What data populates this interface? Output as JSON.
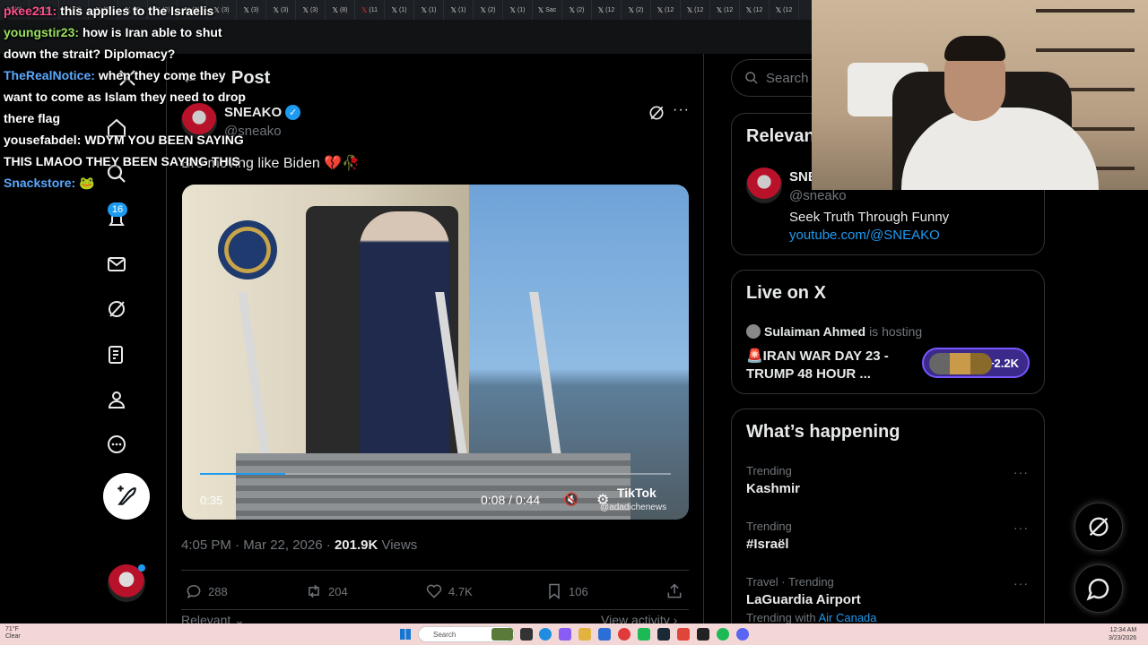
{
  "browser": {
    "tabs": [
      {
        "label": "(3)",
        "red": false
      },
      {
        "label": "(3)",
        "red": false
      },
      {
        "label": "(3)",
        "red": false
      },
      {
        "label": "(3)",
        "red": false
      },
      {
        "label": "(3)",
        "red": false
      },
      {
        "label": "(3)",
        "red": false
      },
      {
        "label": "(3)",
        "red": false
      },
      {
        "label": "(3)",
        "red": false
      },
      {
        "label": "(3)",
        "red": false
      },
      {
        "label": "(3)",
        "red": false
      },
      {
        "label": "(3)",
        "red": false
      },
      {
        "label": "(8)",
        "red": false
      },
      {
        "label": "(11",
        "red": true
      },
      {
        "label": "(1)",
        "red": false
      },
      {
        "label": "(1)",
        "red": false
      },
      {
        "label": "(1)",
        "red": false
      },
      {
        "label": "(2)",
        "red": false
      },
      {
        "label": "(1)",
        "red": false
      },
      {
        "label": "Sac",
        "red": false
      },
      {
        "label": "(2)",
        "red": false
      },
      {
        "label": "(12",
        "red": false
      },
      {
        "label": "(2)",
        "red": false
      },
      {
        "label": "(12",
        "red": false
      },
      {
        "label": "(12",
        "red": false
      },
      {
        "label": "(12",
        "red": false
      },
      {
        "label": "(12",
        "red": false
      },
      {
        "label": "(12",
        "red": false
      }
    ]
  },
  "chat": [
    {
      "user": "pkee211:",
      "color": "#ff4f8b",
      "text": "this applies to the Israelis"
    },
    {
      "user": "youngstir23:",
      "color": "#9be15d",
      "text": "how is Iran able to shut down the strait? Diplomacy?"
    },
    {
      "user": "TheRealNotice:",
      "color": "#5aa9ff",
      "text": "when they come they want to come as Islam they need to drop there flag"
    },
    {
      "user": "yousefabdel:",
      "color": "#ffffff",
      "text": "WDYM YOU BEEN SAYING THIS LMAOO THEY BEEN SAYING THIS"
    },
    {
      "user": "Snackstore:",
      "color": "#5aa9ff",
      "text": "🐸"
    }
  ],
  "nav": {
    "notifications_badge": "16"
  },
  "post": {
    "header": "Post",
    "author_name": "SNEAKO",
    "author_handle": "@sneako",
    "text": "Bro moving like Biden 💔🥀",
    "video": {
      "elapsed_left": "0:35",
      "time": "0:08 / 0:44",
      "progress_fraction": 0.18,
      "watermark": "TikTok",
      "watermark_handle": "@adadichenews"
    },
    "timestamp": "4:05 PM · Mar 22, 2026",
    "views_count": "201.9K",
    "views_label": "Views",
    "actions": {
      "replies": "288",
      "reposts": "204",
      "likes": "4.7K",
      "bookmarks": "106"
    },
    "relevant_label": "Relevant",
    "view_activity_label": "View activity"
  },
  "sidebar": {
    "search_placeholder": "Search",
    "relevant_people": {
      "title": "Relevant people",
      "name": "SNEAKO",
      "handle": "@sneako",
      "bio": "Seek Truth Through Funny",
      "link": "youtube.com/@SNEAKO"
    },
    "live": {
      "title": "Live on X",
      "host_name": "Sulaiman Ahmed",
      "host_suffix": "is hosting",
      "space_title": "🚨IRAN WAR DAY 23 - TRUMP 48 HOUR ...",
      "listeners": "+2.2K"
    },
    "happening": {
      "title": "What’s happening",
      "trends": [
        {
          "category": "Trending",
          "name": "Kashmir",
          "sub": "",
          "sub_link": ""
        },
        {
          "category": "Trending",
          "name": "#Israël",
          "sub": "",
          "sub_link": ""
        },
        {
          "category": "Travel · Trending",
          "name": "LaGuardia Airport",
          "sub": "Trending with",
          "sub_link": "Air Canada"
        }
      ]
    }
  },
  "taskbar": {
    "weather_temp": "71°F",
    "weather_desc": "Clear",
    "search_label": "Search",
    "time": "12:34 AM",
    "date": "3/23/2026"
  }
}
